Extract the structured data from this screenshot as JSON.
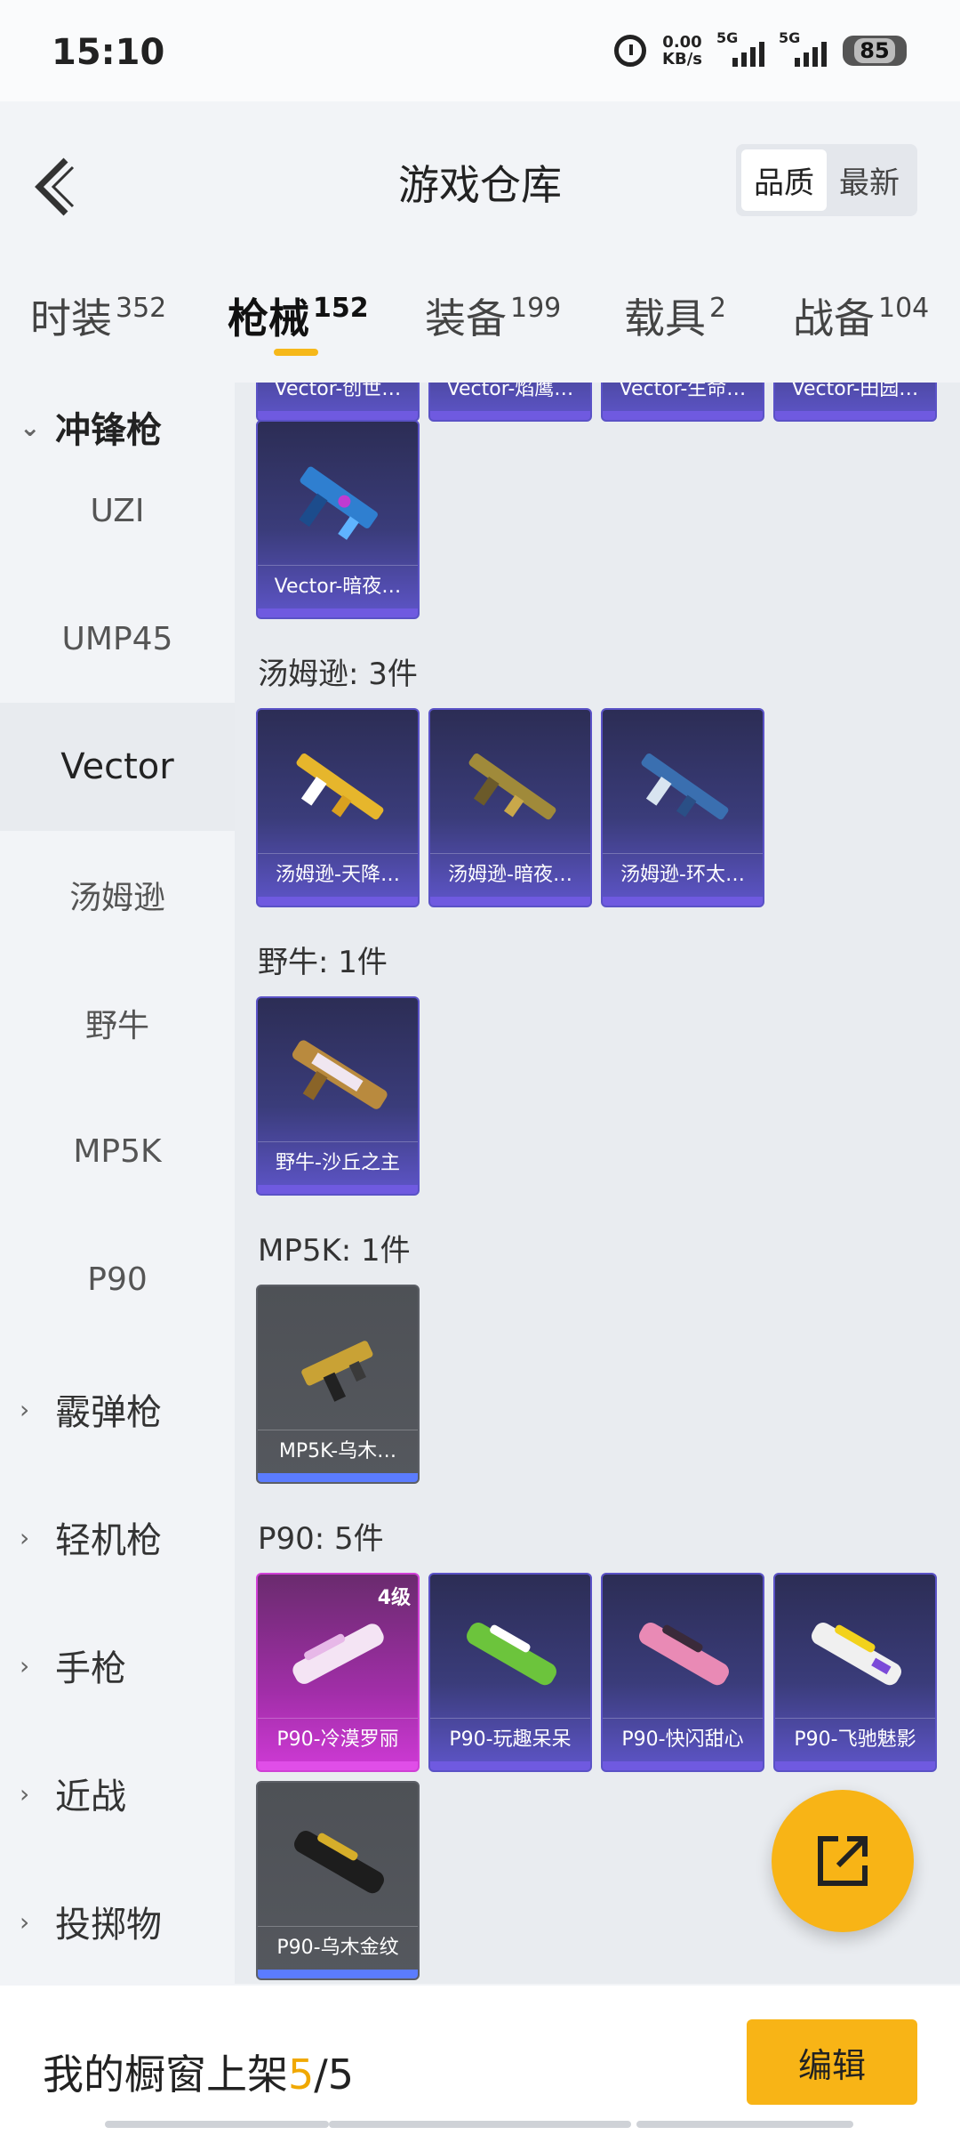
{
  "status_bar": {
    "time": "15:10",
    "net_speed_value": "0.00",
    "net_speed_unit": "KB/s",
    "signal_1_label": "5G",
    "signal_2_label": "5G",
    "battery": "85"
  },
  "header": {
    "title": "游戏仓库",
    "sort_options": [
      "品质",
      "最新"
    ],
    "sort_selected": "品质"
  },
  "tabs": [
    {
      "label": "时装",
      "count": "352"
    },
    {
      "label": "枪械",
      "count": "152"
    },
    {
      "label": "装备",
      "count": "199"
    },
    {
      "label": "载具",
      "count": "2"
    },
    {
      "label": "战备",
      "count": "104"
    }
  ],
  "active_tab": "枪械",
  "sidebar": {
    "open_category": "冲锋枪",
    "subcategories": [
      "UZI",
      "UMP45",
      "Vector",
      "汤姆逊",
      "野牛",
      "MP5K",
      "P90"
    ],
    "selected_sub": "Vector",
    "other_categories": [
      "霰弹枪",
      "轻机枪",
      "手枪",
      "近战",
      "投掷物"
    ]
  },
  "content": {
    "top_partial_captions": [
      "Vector-创世…",
      "Vector-焰鹰…",
      "Vector-生命…",
      "Vector-田园…"
    ],
    "vector_card_caption": "Vector-暗夜…",
    "groups": [
      {
        "label": "汤姆逊: 3件",
        "items": [
          "汤姆逊-天降…",
          "汤姆逊-暗夜…",
          "汤姆逊-环太…"
        ]
      },
      {
        "label": "野牛: 1件",
        "items": [
          "野牛-沙丘之主"
        ]
      },
      {
        "label": "MP5K: 1件",
        "items": [
          "MP5K-乌木…"
        ]
      },
      {
        "label": "P90: 5件",
        "items": [
          "P90-冷漠罗丽",
          "P90-玩趣呆呆",
          "P90-快闪甜心",
          "P90-飞驰魅影",
          "P90-乌木金纹"
        ]
      }
    ],
    "p90_level_badge": "4级"
  },
  "bottom_bar": {
    "text_prefix": "我的橱窗上架",
    "shelf_count": "5",
    "shelf_total": "/5",
    "edit_label": "编辑"
  },
  "colors": {
    "accent": "#f8b416",
    "card_purple": "#5a52c6",
    "card_pink": "#d040d6",
    "card_gray": "#55585e"
  }
}
